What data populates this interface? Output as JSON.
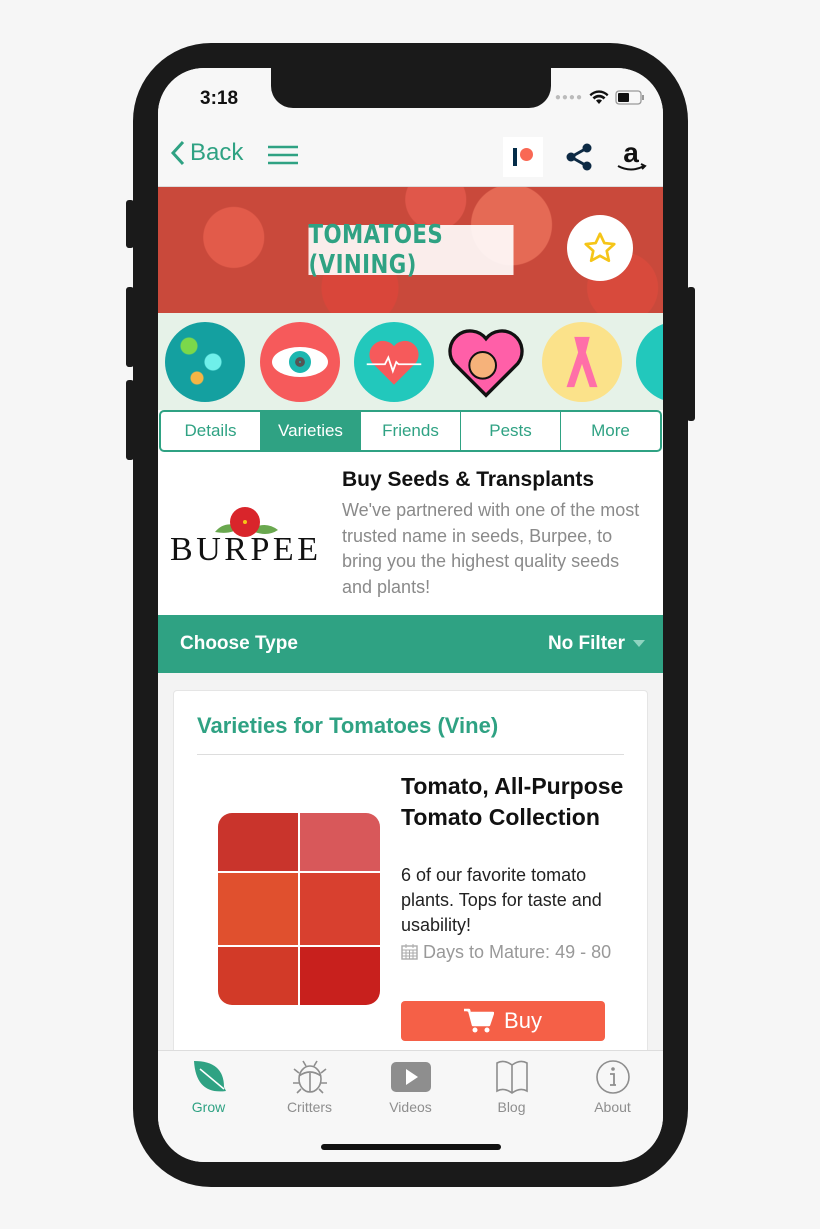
{
  "status": {
    "time": "3:18"
  },
  "nav": {
    "back_label": "Back"
  },
  "hero": {
    "title": "TOMATOES (VINING)"
  },
  "benefit_icons": [
    "microbes-icon",
    "eye-icon",
    "heart-rate-icon",
    "pregnancy-heart-icon",
    "ribbon-icon",
    "partial-icon"
  ],
  "tabs": [
    {
      "label": "Details",
      "active": false
    },
    {
      "label": "Varieties",
      "active": true
    },
    {
      "label": "Friends",
      "active": false
    },
    {
      "label": "Pests",
      "active": false
    },
    {
      "label": "More",
      "active": false
    }
  ],
  "partner": {
    "logo_text": "BURPEE",
    "title": "Buy Seeds & Transplants",
    "text": "We've partnered with one of the most trusted name in seeds, Burpee, to bring you the highest quality seeds and plants!"
  },
  "filter": {
    "label": "Choose Type",
    "value": "No Filter"
  },
  "varieties": {
    "heading": "Varieties for Tomatoes (Vine)",
    "items": [
      {
        "title": "Tomato, All-Purpose Tomato Collection",
        "description": "6 of our favorite tomato plants. Tops for taste and usability!",
        "days": "Days to Mature: 49 - 80",
        "buy_label": "Buy"
      }
    ]
  },
  "tabbar": [
    {
      "label": "Grow",
      "icon": "leaf-icon",
      "active": true
    },
    {
      "label": "Critters",
      "icon": "bug-icon",
      "active": false
    },
    {
      "label": "Videos",
      "icon": "play-icon",
      "active": false
    },
    {
      "label": "Blog",
      "icon": "book-icon",
      "active": false
    },
    {
      "label": "About",
      "icon": "info-icon",
      "active": false
    }
  ],
  "colors": {
    "accent": "#2fa283",
    "buy": "#f56047",
    "star": "#f5c518"
  }
}
